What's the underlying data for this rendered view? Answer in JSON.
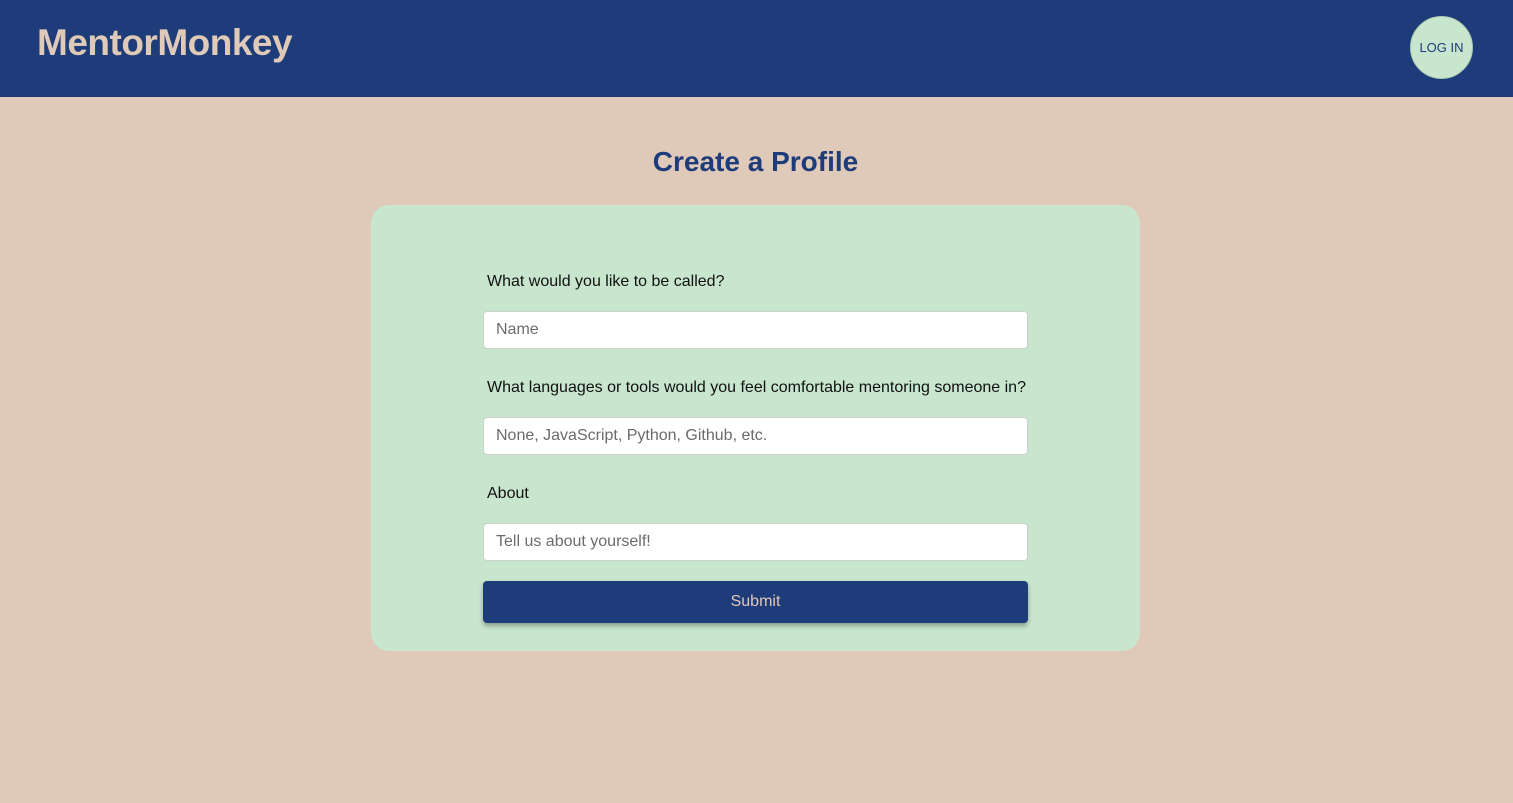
{
  "header": {
    "brand": "MentorMonkey",
    "login_label": "LOG IN"
  },
  "page": {
    "title": "Create a Profile"
  },
  "form": {
    "name_label": "What would you like to be called?",
    "name_value": "",
    "name_placeholder": "Name",
    "languages_label": "What languages or tools would you feel comfortable mentoring someone in?",
    "languages_value": "",
    "languages_placeholder": "None, JavaScript, Python, Github, etc.",
    "about_label": "About",
    "about_value": "",
    "about_placeholder": "Tell us about yourself!",
    "submit_label": "Submit"
  },
  "colors": {
    "header_bg": "#1e3c79",
    "page_bg": "#dfc9b8",
    "card_bg": "#c8e5cd",
    "accent": "#1e3c79"
  }
}
